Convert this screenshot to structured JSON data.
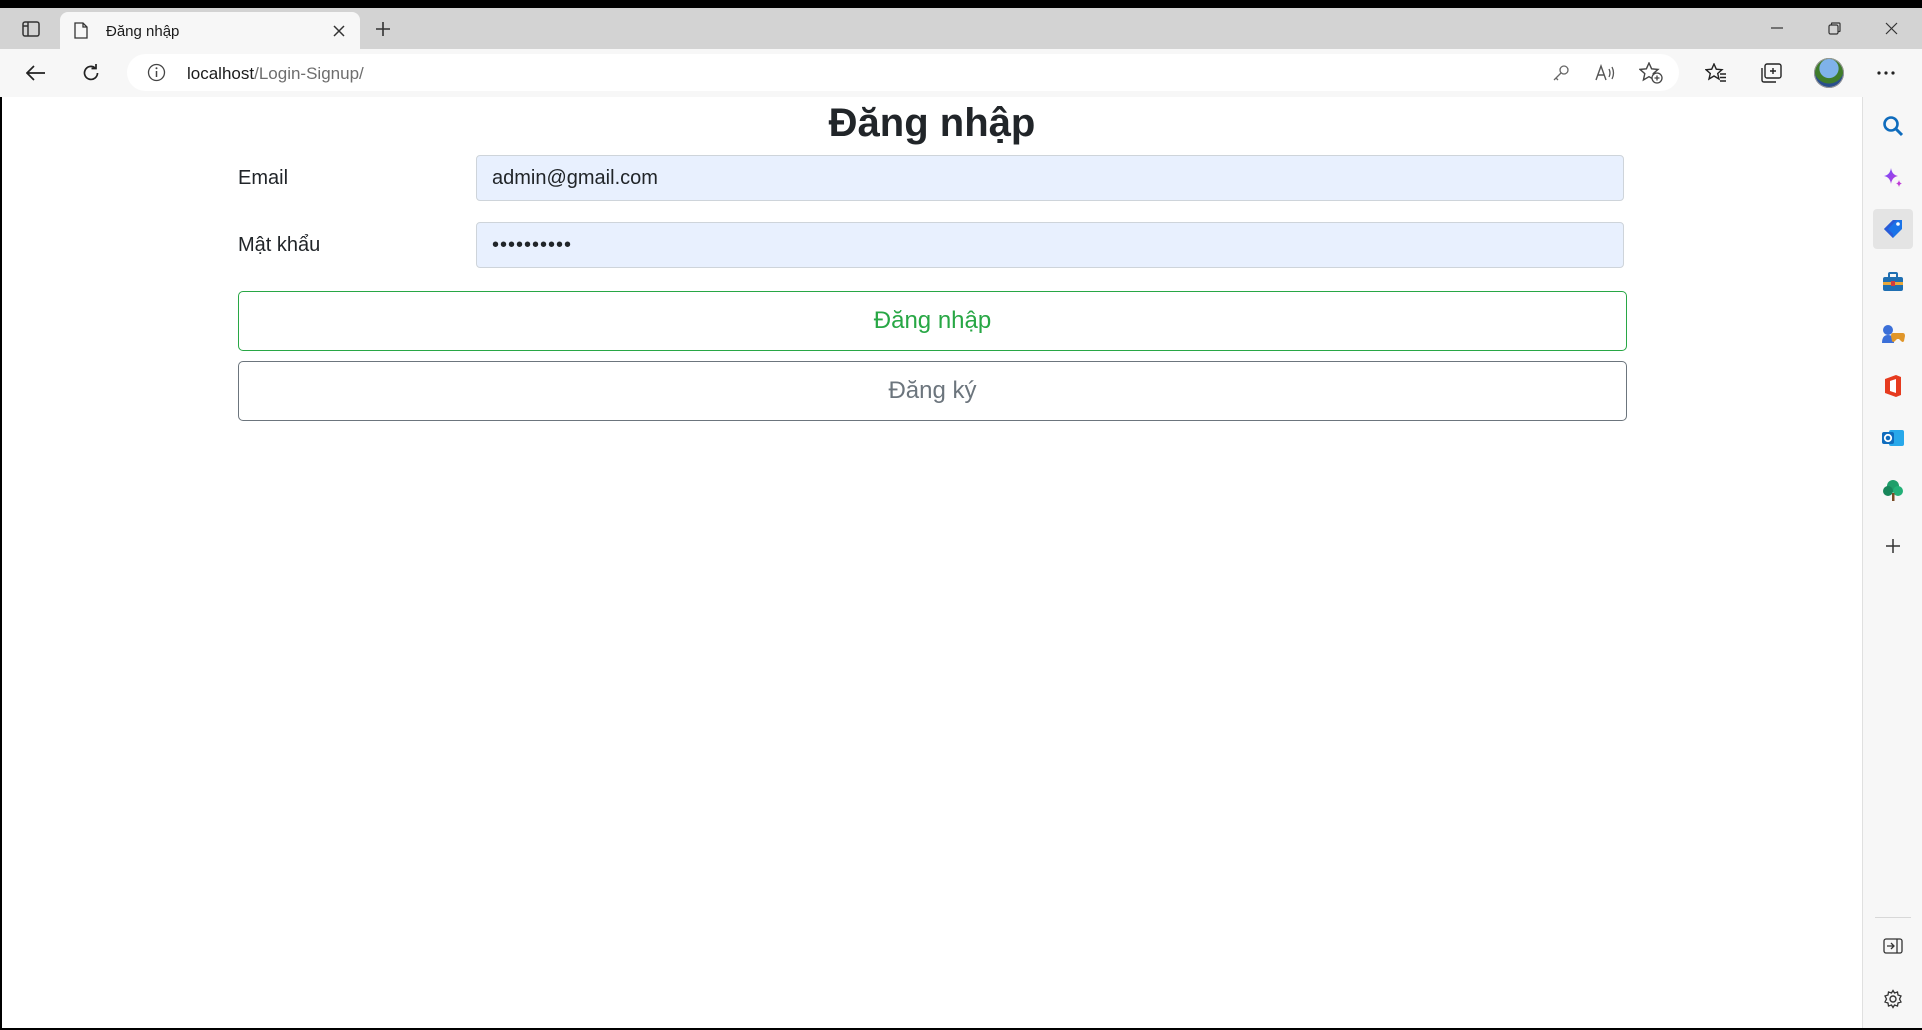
{
  "browser": {
    "tab": {
      "title": "Đăng nhập"
    },
    "address": {
      "host": "localhost",
      "path": "/Login-Signup/"
    },
    "icons": {
      "tab_actions": "tab-actions-icon",
      "new_tab": "plus-icon",
      "back": "back-arrow-icon",
      "reload": "reload-icon",
      "site_info": "info-icon",
      "password": "key-icon",
      "read_aloud": "read-aloud-icon",
      "add_favorite": "star-add-icon",
      "favorites": "favorites-icon",
      "collections": "collections-icon",
      "more": "more-icon"
    }
  },
  "page": {
    "title": "Đăng nhập",
    "email_label": "Email",
    "email_value": "admin@gmail.com",
    "password_label": "Mật khẩu",
    "password_value": "1234567890",
    "login_button": "Đăng nhập",
    "signup_button": "Đăng ký"
  },
  "colors": {
    "login_accent": "#28a745",
    "signup_accent": "#6c757d",
    "autofill_bg": "#e8f0fe",
    "edge_blue": "#0f6cbd"
  },
  "sidebar": {
    "items": [
      "search-icon",
      "copilot-icon",
      "shopping-tag-icon",
      "tools-icon",
      "games-icon",
      "office-icon",
      "outlook-icon",
      "tree-icon",
      "add-icon"
    ],
    "bottom": [
      "hide-sidebar-icon",
      "settings-icon"
    ]
  }
}
